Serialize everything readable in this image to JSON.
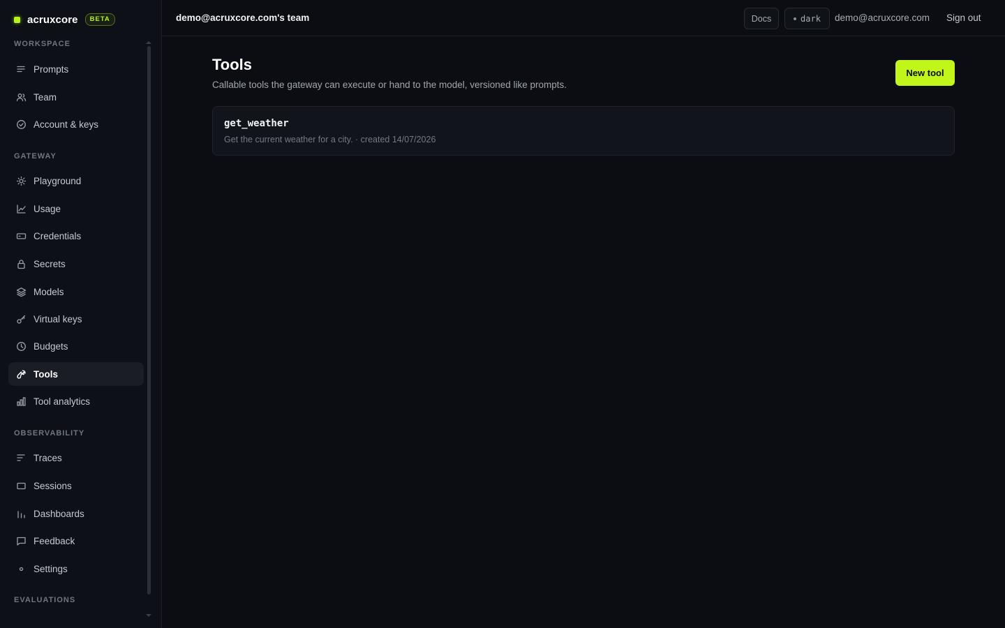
{
  "brand": {
    "name": "acruxcore",
    "badge": "BETA",
    "accent": "#b6f31c"
  },
  "sidebar": {
    "sections": [
      {
        "title": "WORKSPACE",
        "items": [
          {
            "label": "Prompts",
            "icon": "list-icon"
          },
          {
            "label": "Team",
            "icon": "users-icon"
          },
          {
            "label": "Account & keys",
            "icon": "check-circle-icon"
          }
        ]
      },
      {
        "title": "GATEWAY",
        "items": [
          {
            "label": "Playground",
            "icon": "sun-icon"
          },
          {
            "label": "Usage",
            "icon": "line-chart-icon"
          },
          {
            "label": "Credentials",
            "icon": "card-icon"
          },
          {
            "label": "Secrets",
            "icon": "lock-icon"
          },
          {
            "label": "Models",
            "icon": "layers-icon"
          },
          {
            "label": "Virtual keys",
            "icon": "key-icon"
          },
          {
            "label": "Budgets",
            "icon": "clock-icon"
          },
          {
            "label": "Tools",
            "icon": "wrench-icon",
            "active": true
          },
          {
            "label": "Tool analytics",
            "icon": "bar-chart-icon"
          }
        ]
      },
      {
        "title": "OBSERVABILITY",
        "items": [
          {
            "label": "Traces",
            "icon": "traces-icon"
          },
          {
            "label": "Sessions",
            "icon": "window-icon"
          },
          {
            "label": "Dashboards",
            "icon": "bars-icon"
          },
          {
            "label": "Feedback",
            "icon": "message-icon"
          },
          {
            "label": "Settings",
            "icon": "dot-icon"
          }
        ]
      },
      {
        "title": "EVALUATIONS",
        "items": []
      }
    ]
  },
  "topbar": {
    "team": "demo@acruxcore.com's team",
    "docs": "Docs",
    "theme": "dark",
    "email": "demo@acruxcore.com",
    "signout": "Sign out"
  },
  "main": {
    "title": "Tools",
    "subtitle": "Callable tools the gateway can execute or hand to the model, versioned like prompts.",
    "new_button": "New tool",
    "tools": [
      {
        "name": "get_weather",
        "meta": "Get the current weather for a city. · created 14/07/2026"
      }
    ]
  }
}
